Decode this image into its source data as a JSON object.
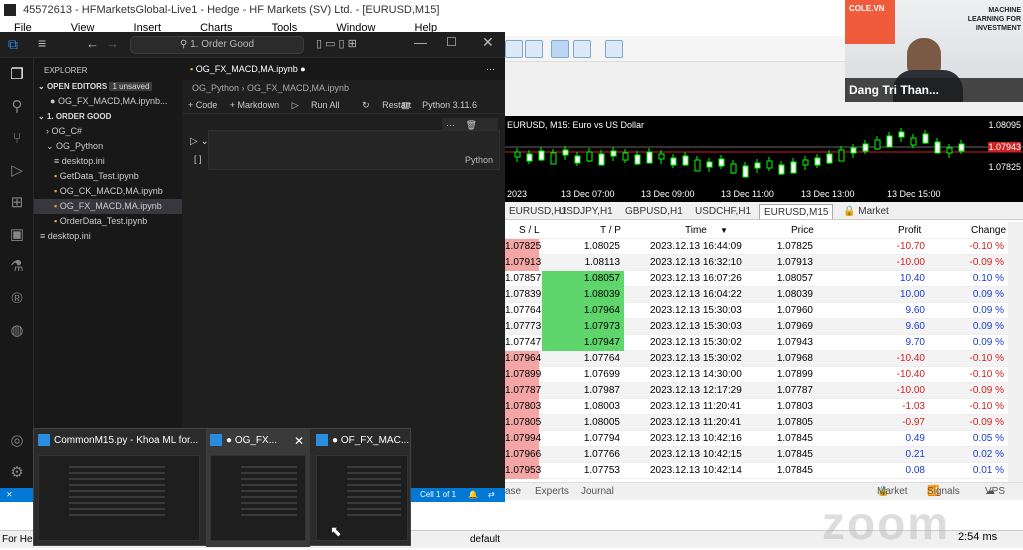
{
  "mt4": {
    "title": "45572613 - HFMarketsGlobal-Live1 - Hedge - HF Markets (SV) Ltd. - [EURUSD,M15]",
    "menu": [
      "File",
      "View",
      "Insert",
      "Charts",
      "Tools",
      "Window",
      "Help"
    ],
    "chart": {
      "label": "EURUSD, M15:  Euro vs US Dollar",
      "price_labels": [
        "1.08095",
        "1.07943",
        "1.07825"
      ],
      "time_labels": [
        "2023",
        "13 Dec 07:00",
        "13 Dec 09:00",
        "13 Dec 11:00",
        "13 Dec 13:00",
        "13 Dec 15:00"
      ]
    },
    "tabs": [
      "EURUSD,H1",
      "USDJPY,H1",
      "GBPUSD,H1",
      "USDCHF,H1",
      "EURUSD,M15",
      "Market"
    ],
    "table": {
      "headers": [
        "S / L",
        "T / P",
        "Time",
        "Price",
        "Profit",
        "Change"
      ],
      "rows": [
        {
          "sl": "1.07825",
          "tp": "1.08025",
          "time": "2023.12.13 16:44:09",
          "price": "1.07825",
          "profit": "-10.70",
          "change": "-0.10 %"
        },
        {
          "sl": "1.07913",
          "tp": "1.08113",
          "time": "2023.12.13 16:32:10",
          "price": "1.07913",
          "profit": "-10.00",
          "change": "-0.09 %"
        },
        {
          "sl": "1.07857",
          "tp": "1.08057",
          "time": "2023.12.13 16:07:26",
          "price": "1.08057",
          "profit": "10.40",
          "change": "0.10 %"
        },
        {
          "sl": "1.07839",
          "tp": "1.08039",
          "time": "2023.12.13 16:04:22",
          "price": "1.08039",
          "profit": "10.00",
          "change": "0.09 %"
        },
        {
          "sl": "1.07764",
          "tp": "1.07964",
          "time": "2023.12.13 15:30:03",
          "price": "1.07960",
          "profit": "9.60",
          "change": "0.09 %"
        },
        {
          "sl": "1.07773",
          "tp": "1.07973",
          "time": "2023.12.13 15:30:03",
          "price": "1.07969",
          "profit": "9.60",
          "change": "0.09 %"
        },
        {
          "sl": "1.07747",
          "tp": "1.07947",
          "time": "2023.12.13 15:30:02",
          "price": "1.07943",
          "profit": "9.70",
          "change": "0.09 %"
        },
        {
          "sl": "1.07964",
          "tp": "1.07764",
          "time": "2023.12.13 15:30:02",
          "price": "1.07968",
          "profit": "-10.40",
          "change": "-0.10 %"
        },
        {
          "sl": "1.07899",
          "tp": "1.07699",
          "time": "2023.12.13 14:30:00",
          "price": "1.07899",
          "profit": "-10.40",
          "change": "-0.10 %"
        },
        {
          "sl": "1.07787",
          "tp": "1.07987",
          "time": "2023.12.13 12:17:29",
          "price": "1.07787",
          "profit": "-10.00",
          "change": "-0.09 %"
        },
        {
          "sl": "1.07803",
          "tp": "1.08003",
          "time": "2023.12.13 11:20:41",
          "price": "1.07803",
          "profit": "-1.03",
          "change": "-0.10 %"
        },
        {
          "sl": "1.07805",
          "tp": "1.08005",
          "time": "2023.12.13 11:20:41",
          "price": "1.07805",
          "profit": "-0.97",
          "change": "-0.09 %"
        },
        {
          "sl": "1.07994",
          "tp": "1.07794",
          "time": "2023.12.13 10:42:16",
          "price": "1.07845",
          "profit": "0.49",
          "change": "0.05 %"
        },
        {
          "sl": "1.07966",
          "tp": "1.07766",
          "time": "2023.12.13 10:42:15",
          "price": "1.07845",
          "profit": "0.21",
          "change": "0.02 %"
        },
        {
          "sl": "1.07953",
          "tp": "1.07753",
          "time": "2023.12.13 10:42:14",
          "price": "1.07845",
          "profit": "0.08",
          "change": "0.01 %"
        }
      ]
    },
    "bottom_tabs": [
      "ase",
      "Experts",
      "Journal"
    ],
    "bottom_right": [
      "Market",
      "Signals",
      "VPS"
    ],
    "status_left": "For Help",
    "status_mid": "default",
    "clock": "2:54 ms"
  },
  "webcam": {
    "logo": "COLE.VN",
    "brand": "MACHINE LEARNING FOR INVESTMENT",
    "name": "Dang Tri Than..."
  },
  "vscode": {
    "search": "1. Order Good",
    "explorer_header": "EXPLORER",
    "open_editors": "OPEN EDITORS",
    "unsaved": "1 unsaved",
    "open_file": "OG_FX_MACD,MA.ipynb...",
    "folder": "1. ORDER GOOD",
    "tree": [
      "OG_C#",
      "OG_Python",
      "desktop.ini",
      "GetData_Test.ipynb",
      "OG_CK_MACD,MA.ipynb",
      "OG_FX_MACD,MA.ipynb",
      "OrderData_Test.ipynb",
      "desktop.ini"
    ],
    "tab_label": "OG_FX_MACD,MA.ipynb",
    "breadcrumb": [
      "OG_Python",
      "OG_FX_MACD,MA.ipynb"
    ],
    "nb_toolbar": [
      "+ Code",
      "+ Markdown",
      "Run All",
      "Restart",
      "Python 3.11.6"
    ],
    "cell_lang": "Python",
    "status_cell": "Cell 1 of 1"
  },
  "taskbar": {
    "items": [
      "CommonM15.py - Khoa ML for...",
      "● OG_FX...",
      "● OF_FX_MAC..."
    ]
  },
  "watermark": "zoom"
}
